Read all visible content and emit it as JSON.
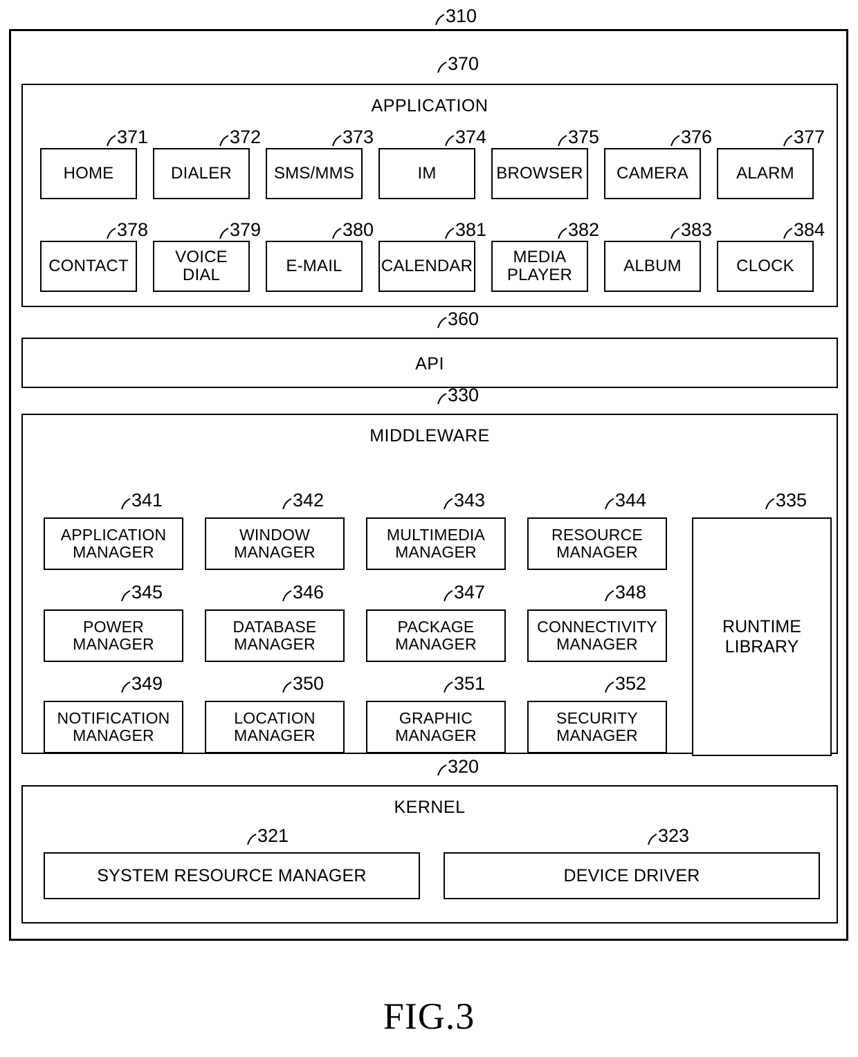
{
  "figure": {
    "caption": "FIG.3",
    "outer_ref": "310"
  },
  "layers": {
    "application": {
      "ref": "370",
      "title": "APPLICATION",
      "row1": [
        {
          "ref": "371",
          "label": "HOME"
        },
        {
          "ref": "372",
          "label": "DIALER"
        },
        {
          "ref": "373",
          "label": "SMS/MMS"
        },
        {
          "ref": "374",
          "label": "IM"
        },
        {
          "ref": "375",
          "label": "BROWSER"
        },
        {
          "ref": "376",
          "label": "CAMERA"
        },
        {
          "ref": "377",
          "label": "ALARM"
        }
      ],
      "row2": [
        {
          "ref": "378",
          "label": "CONTACT"
        },
        {
          "ref": "379",
          "label": "VOICE DIAL"
        },
        {
          "ref": "380",
          "label": "E-MAIL"
        },
        {
          "ref": "381",
          "label": "CALENDAR"
        },
        {
          "ref": "382",
          "label": "MEDIA PLAYER"
        },
        {
          "ref": "383",
          "label": "ALBUM"
        },
        {
          "ref": "384",
          "label": "CLOCK"
        }
      ]
    },
    "api": {
      "ref": "360",
      "title": "API"
    },
    "middleware": {
      "ref": "330",
      "title": "MIDDLEWARE",
      "row1": [
        {
          "ref": "341",
          "label": "APPLICATION MANAGER"
        },
        {
          "ref": "342",
          "label": "WINDOW MANAGER"
        },
        {
          "ref": "343",
          "label": "MULTIMEDIA MANAGER"
        },
        {
          "ref": "344",
          "label": "RESOURCE MANAGER"
        }
      ],
      "row2": [
        {
          "ref": "345",
          "label": "POWER MANAGER"
        },
        {
          "ref": "346",
          "label": "DATABASE MANAGER"
        },
        {
          "ref": "347",
          "label": "PACKAGE MANAGER"
        },
        {
          "ref": "348",
          "label": "CONNECTIVITY MANAGER"
        }
      ],
      "row3": [
        {
          "ref": "349",
          "label": "NOTIFICATION MANAGER"
        },
        {
          "ref": "350",
          "label": "LOCATION MANAGER"
        },
        {
          "ref": "351",
          "label": "GRAPHIC MANAGER"
        },
        {
          "ref": "352",
          "label": "SECURITY MANAGER"
        }
      ],
      "runtime_library": {
        "ref": "335",
        "label": "RUNTIME LIBRARY"
      }
    },
    "kernel": {
      "ref": "320",
      "title": "KERNEL",
      "modules": [
        {
          "ref": "321",
          "label": "SYSTEM RESOURCE MANAGER"
        },
        {
          "ref": "323",
          "label": "DEVICE DRIVER"
        }
      ]
    }
  }
}
